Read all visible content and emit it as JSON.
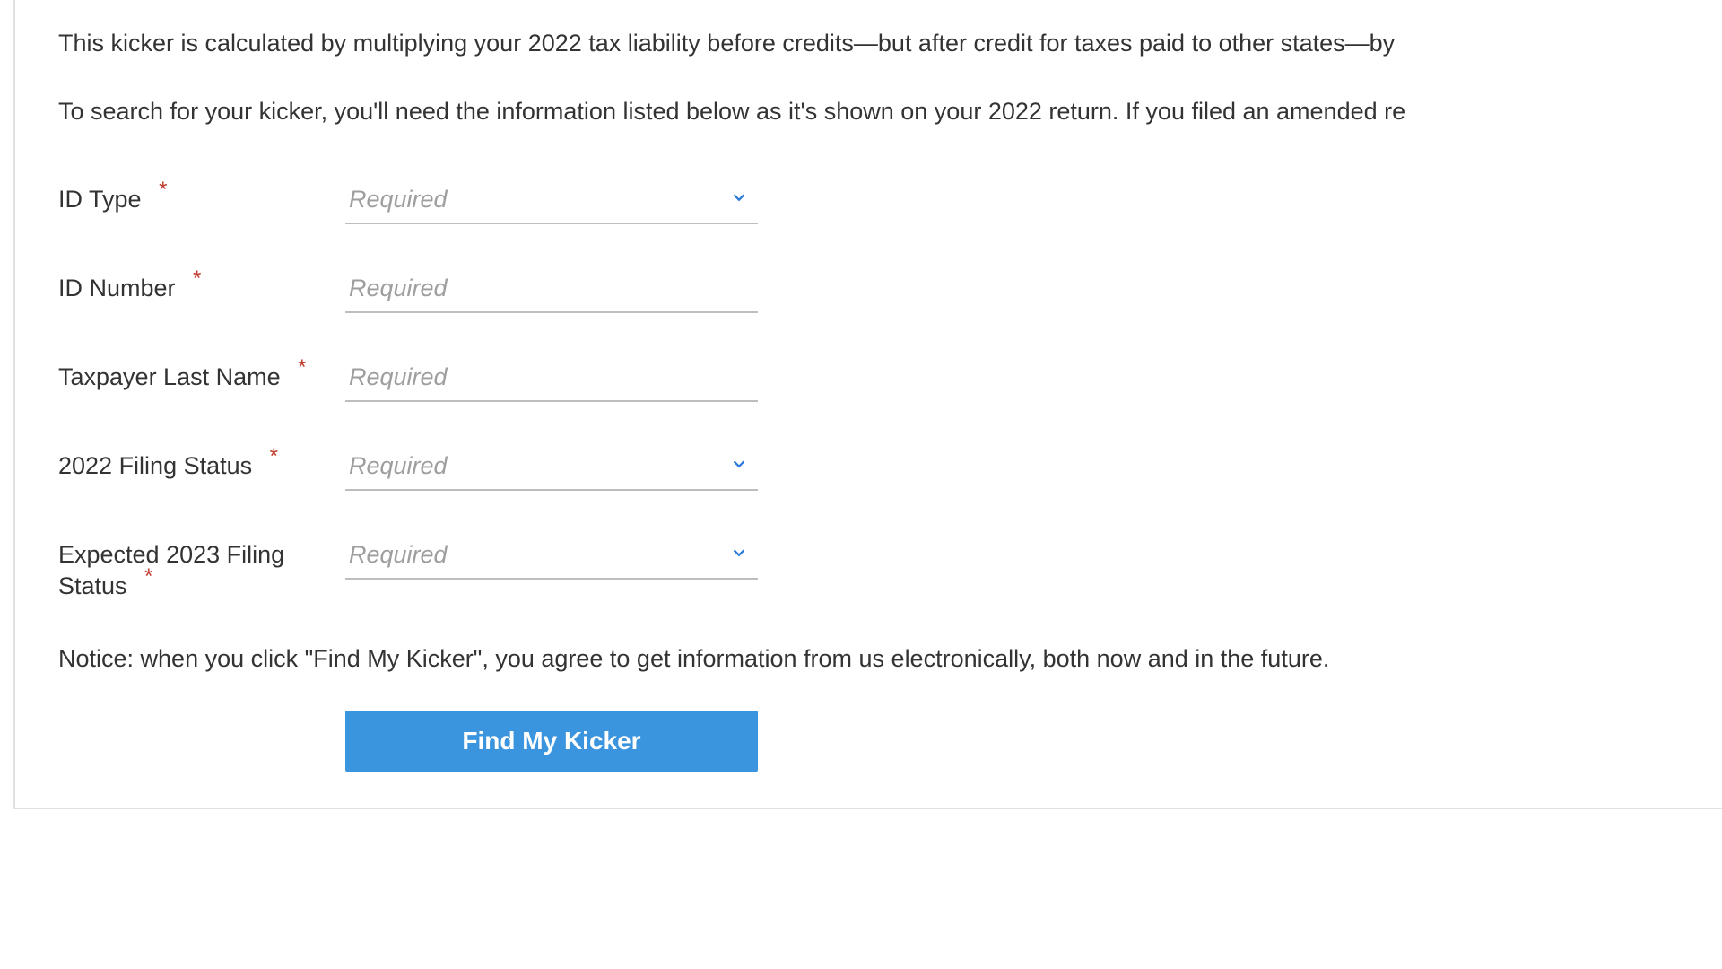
{
  "intro": {
    "line1": "This kicker is calculated by multiplying your 2022 tax liability before credits—but after credit for taxes paid to other states—by",
    "line2": "To search for your kicker, you'll need the information listed below as it's shown on your 2022 return. If you filed an amended re"
  },
  "form": {
    "fields": [
      {
        "label": "ID Type",
        "placeholder": "Required",
        "type": "select"
      },
      {
        "label": "ID Number",
        "placeholder": "Required",
        "type": "text"
      },
      {
        "label": "Taxpayer Last Name",
        "placeholder": "Required",
        "type": "text"
      },
      {
        "label": "2022 Filing Status",
        "placeholder": "Required",
        "type": "select"
      },
      {
        "label": "Expected 2023 Filing Status",
        "placeholder": "Required",
        "type": "select"
      }
    ],
    "required_marker": "*"
  },
  "notice": "Notice: when you click \"Find My Kicker\", you agree to get information from us electronically, both now and in the future.",
  "submit_label": "Find My Kicker",
  "colors": {
    "accent": "#3a94de",
    "chevron": "#2979d9",
    "required": "#c0392b"
  }
}
